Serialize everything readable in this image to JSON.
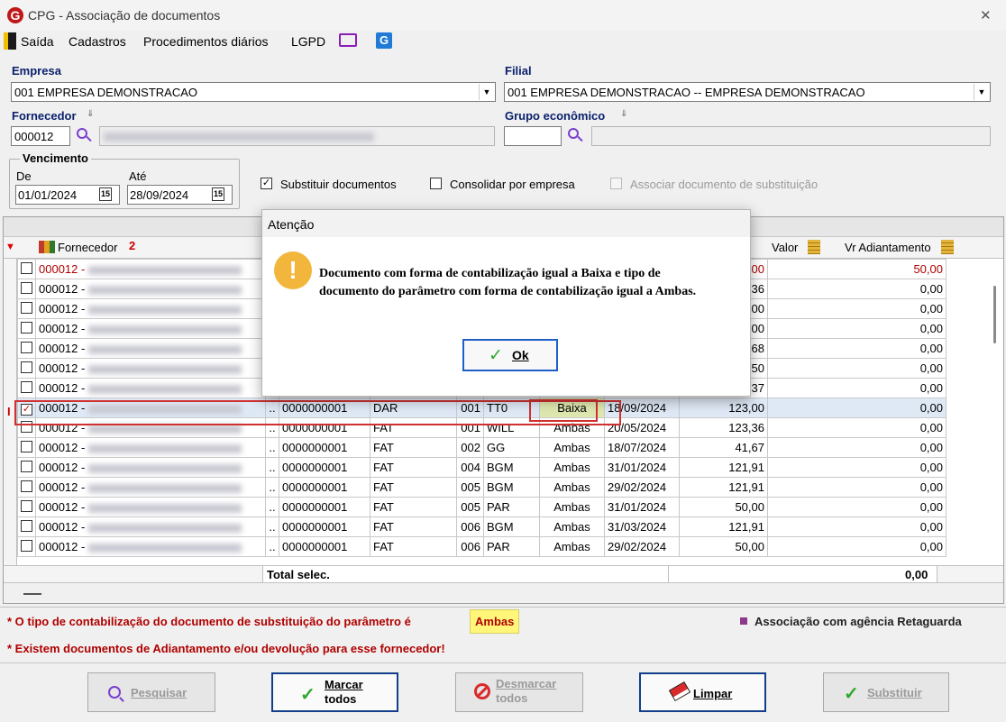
{
  "window": {
    "title": "CPG - Associação de documentos",
    "close": "✕"
  },
  "menu": {
    "items": [
      "Saída",
      "Cadastros",
      "Procedimentos diários",
      "LGPD"
    ]
  },
  "empresa": {
    "label": "Empresa",
    "value": "001 EMPRESA DEMONSTRACAO"
  },
  "filial": {
    "label": "Filial",
    "value": "001 EMPRESA DEMONSTRACAO -- EMPRESA DEMONSTRACAO"
  },
  "fornecedor": {
    "label": "Fornecedor",
    "code": "000012"
  },
  "grupo": {
    "label": "Grupo econômico",
    "code": ""
  },
  "vencimento": {
    "label": "Vencimento",
    "de_label": "De",
    "de": "01/01/2024",
    "ate_label": "Até",
    "ate": "28/09/2024",
    "cal": "15"
  },
  "options": {
    "substituir": "Substituir documentos",
    "consolidar": "Consolidar por empresa",
    "associar": "Associar documento de substituição"
  },
  "grid": {
    "headers": {
      "fornecedor": "Fornecedor",
      "sort": "2",
      "valor": "Valor",
      "vr_adiant": "Vr Adiantamento"
    },
    "rows": [
      {
        "forn": "000012 -",
        "doc": "",
        "tipo": "",
        "parc": "",
        "sit": "",
        "forma": "",
        "venc": "",
        "valor": "118,00",
        "adiant": "50,00"
      },
      {
        "forn": "000012 -",
        "doc": "",
        "tipo": "",
        "parc": "",
        "sit": "",
        "forma": "",
        "venc": "",
        "valor": "123,36",
        "adiant": "0,00"
      },
      {
        "forn": "000012 -",
        "doc": "",
        "tipo": "",
        "parc": "",
        "sit": "",
        "forma": "",
        "venc": "",
        "valor": "120,00",
        "adiant": "0,00"
      },
      {
        "forn": "000012 -",
        "doc": "",
        "tipo": "",
        "parc": "",
        "sit": "",
        "forma": "",
        "venc": "",
        "valor": "523,00",
        "adiant": "0,00"
      },
      {
        "forn": "000012 -",
        "doc": "",
        "tipo": "",
        "parc": "",
        "sit": "",
        "forma": "",
        "venc": "",
        "valor": "894,68",
        "adiant": "0,00"
      },
      {
        "forn": "000012 -",
        "doc": "",
        "tipo": "",
        "parc": "",
        "sit": "",
        "forma": "",
        "venc": "",
        "valor": "6.016,50",
        "adiant": "0,00"
      },
      {
        "forn": "000012 -",
        "doc": "",
        "tipo": "",
        "parc": "",
        "sit": "",
        "forma": "",
        "venc": "",
        "valor": "1.537,37",
        "adiant": "0,00"
      },
      {
        "forn": "000012 -",
        "doc": "0000000001",
        "tipo": "DAR",
        "parc": "001",
        "sit": "TT0",
        "forma": "Baixa",
        "venc": "18/09/2024",
        "valor": "123,00",
        "adiant": "0,00"
      },
      {
        "forn": "000012 -",
        "doc": "0000000001",
        "tipo": "FAT",
        "parc": "001",
        "sit": "WILL",
        "forma": "Ambas",
        "venc": "20/05/2024",
        "valor": "123,36",
        "adiant": "0,00"
      },
      {
        "forn": "000012 -",
        "doc": "0000000001",
        "tipo": "FAT",
        "parc": "002",
        "sit": "GG",
        "forma": "Ambas",
        "venc": "18/07/2024",
        "valor": "41,67",
        "adiant": "0,00"
      },
      {
        "forn": "000012 -",
        "doc": "0000000001",
        "tipo": "FAT",
        "parc": "004",
        "sit": "BGM",
        "forma": "Ambas",
        "venc": "31/01/2024",
        "valor": "121,91",
        "adiant": "0,00"
      },
      {
        "forn": "000012 -",
        "doc": "0000000001",
        "tipo": "FAT",
        "parc": "005",
        "sit": "BGM",
        "forma": "Ambas",
        "venc": "29/02/2024",
        "valor": "121,91",
        "adiant": "0,00"
      },
      {
        "forn": "000012 -",
        "doc": "0000000001",
        "tipo": "FAT",
        "parc": "005",
        "sit": "PAR",
        "forma": "Ambas",
        "venc": "31/01/2024",
        "valor": "50,00",
        "adiant": "0,00"
      },
      {
        "forn": "000012 -",
        "doc": "0000000001",
        "tipo": "FAT",
        "parc": "006",
        "sit": "BGM",
        "forma": "Ambas",
        "venc": "31/03/2024",
        "valor": "121,91",
        "adiant": "0,00"
      },
      {
        "forn": "000012 -",
        "doc": "0000000001",
        "tipo": "FAT",
        "parc": "006",
        "sit": "PAR",
        "forma": "Ambas",
        "venc": "29/02/2024",
        "valor": "50,00",
        "adiant": "0,00"
      }
    ],
    "total_label": "Total selec.",
    "total_value": "0,00",
    "ellipsis": "..",
    "row_marker": "I"
  },
  "notes": {
    "line1_prefix": "* O tipo de contabilização do documento de substituição do parâmetro é ",
    "line1_value": "Ambas",
    "line2": "* Existem documentos de Adiantamento e/ou devolução para esse fornecedor!",
    "legend": "Associação com agência Retaguarda"
  },
  "buttons": {
    "pesquisar": "Pesquisar",
    "marcar1": "Marcar",
    "marcar2": "todos",
    "desmarcar1": "Desmarcar",
    "desmarcar2": "todos",
    "limpar": "Limpar",
    "substituir": "Substituir"
  },
  "dialog": {
    "title": "Atenção",
    "line1": "Documento com forma de contabilização igual a Baixa e tipo de",
    "line2": "documento do parâmetro com forma de contabilização igual a Ambas.",
    "ok": "Ok"
  },
  "colors": {
    "accent": "#0a1f6b",
    "dialog_icon": "#f2b63c",
    "warn_red": "#b00000",
    "selected_row": "#dfe9f6",
    "highlight_yellow": "#fff67a",
    "baixa_bg": "#dfe7b0",
    "legend": "#8b3a8b"
  }
}
